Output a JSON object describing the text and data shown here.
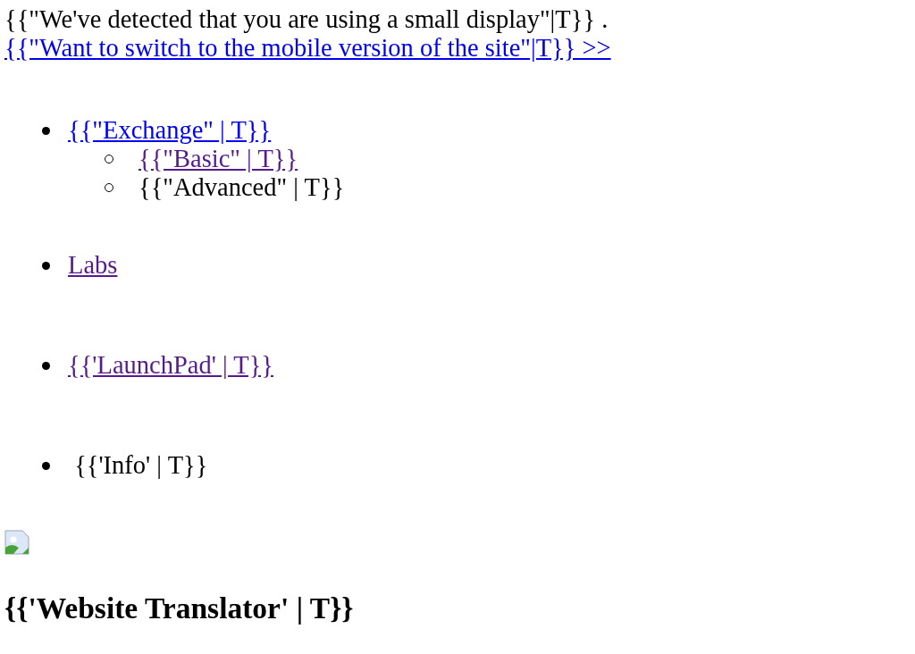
{
  "notice": {
    "text": "{{\"We've detected that you are using a small display\"|T}} .",
    "link": {
      "label": "{{\"Want to switch to the mobile version of the site\"|T}} >>",
      "visited": false
    }
  },
  "nav": [
    {
      "kind": "link",
      "label": "{{\"Exchange\" | T}}",
      "visited": false,
      "children": [
        {
          "kind": "link",
          "label": "{{\"Basic\" | T}}",
          "visited": true
        },
        {
          "kind": "text",
          "label": "{{\"Advanced\" | T}}"
        }
      ]
    },
    {
      "kind": "link",
      "label": "Labs",
      "visited": true
    },
    {
      "kind": "link",
      "label": "{{'LaunchPad' | T}}",
      "visited": true
    },
    {
      "kind": "text",
      "label": " {{'Info' | T}}"
    }
  ],
  "image": {
    "kind": "broken"
  },
  "heading": "{{'Website Translator' | T}}"
}
